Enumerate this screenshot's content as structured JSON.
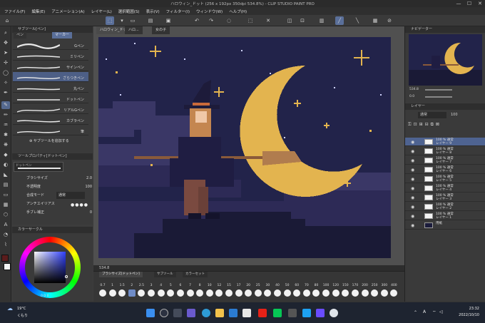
{
  "window": {
    "title": "ハロウィン_ドット (256 x 192px 350dpi 534.8%) - CLIP STUDIO PAINT PRO",
    "controls": [
      "—",
      "☐",
      "✕"
    ]
  },
  "menu": [
    "ファイル(F)",
    "編集(E)",
    "アニメーション(A)",
    "レイヤー(L)",
    "選択範囲(S)",
    "表示(V)",
    "フィルター(I)",
    "ウィンドウ(W)",
    "ヘルプ(H)"
  ],
  "sub_tool_panel": {
    "header": "サブツール[ペン]",
    "tabs": [
      "ペン",
      "マーカー"
    ],
    "brushes": [
      {
        "name": "Gペン",
        "selected": false
      },
      {
        "name": "ミリペン",
        "selected": false
      },
      {
        "name": "サインペン",
        "selected": false
      },
      {
        "name": "ざらつきペン",
        "selected": true
      },
      {
        "name": "丸ペン",
        "selected": false
      },
      {
        "name": "ドットペン",
        "selected": false
      },
      {
        "name": "リアルGペン",
        "selected": false
      },
      {
        "name": "カブラペン",
        "selected": false
      },
      {
        "name": "筆",
        "selected": false
      }
    ],
    "add_label": "サブツールを追加する"
  },
  "tool_property": {
    "header": "ツールプロパティ[ドットペン]",
    "brush_name": "ドットペン",
    "rows": [
      {
        "label": "ブラシサイズ",
        "value": "2.0"
      },
      {
        "label": "不透明度",
        "value": "100"
      },
      {
        "label": "合成モード",
        "value": "通常"
      },
      {
        "label": "アンチエイリアス",
        "value": ""
      },
      {
        "label": "手ブレ補正",
        "value": "0"
      }
    ]
  },
  "color_panel": {
    "header": "カラーサークル",
    "hsv": "0 0 0"
  },
  "canvas": {
    "tabs": [
      "ハロウィン_ドット",
      "ハロ...",
      "女の子"
    ],
    "zoom": "534.8",
    "moon_color": "#e3b44f",
    "sky_color": "#22234a"
  },
  "brush_size_panel": {
    "tabs": [
      "ブラシサイズ[ドットペン]",
      "サブツール",
      "カラーセット"
    ],
    "sizes": [
      "0.7",
      "1",
      "1.5",
      "2",
      "2.5",
      "3",
      "4",
      "5",
      "6",
      "7",
      "8",
      "10",
      "12",
      "15",
      "17",
      "20",
      "25",
      "30",
      "40",
      "50",
      "60",
      "70",
      "80",
      "100",
      "120",
      "150",
      "170",
      "200",
      "250",
      "300",
      "400"
    ],
    "selected": "2"
  },
  "navigator": {
    "header": "ナビゲーター",
    "zoom": "534.8",
    "angle": "0.0"
  },
  "layer_panel": {
    "header": "レイヤー",
    "blend": "通常",
    "opacity": "100",
    "layers": [
      {
        "name": "100 % 通常\nレイヤー 9",
        "selected": true,
        "thumb": "#f4f4f4"
      },
      {
        "name": "100 % 通常\nレイヤー 8",
        "selected": false,
        "thumb": "#f4f4f4"
      },
      {
        "name": "100 % 通常\nレイヤー 7",
        "selected": false,
        "thumb": "#f4f4f4"
      },
      {
        "name": "100 % 通常\nレイヤー 6",
        "selected": false,
        "thumb": "#f4f4f4"
      },
      {
        "name": "100 % 通常\nレイヤー 5",
        "selected": false,
        "thumb": "#f4f4f4"
      },
      {
        "name": "100 % 通常\nレイヤー 4",
        "selected": false,
        "thumb": "#f4f4f4"
      },
      {
        "name": "100 % 通常\nレイヤー 3",
        "selected": false,
        "thumb": "#f4f4f4"
      },
      {
        "name": "100 % 通常\nレイヤー 2",
        "selected": false,
        "thumb": "#f4f4f4"
      },
      {
        "name": "100 % 通常\nレイヤー 1",
        "selected": false,
        "thumb": "#f4f4f4"
      },
      {
        "name": "用紙",
        "selected": false,
        "thumb": "#1b1c3b"
      }
    ]
  },
  "taskbar": {
    "weather_temp": "19°C",
    "weather_desc": "くもり",
    "time": "23:32",
    "date": "2022/10/10",
    "ime": "A"
  }
}
